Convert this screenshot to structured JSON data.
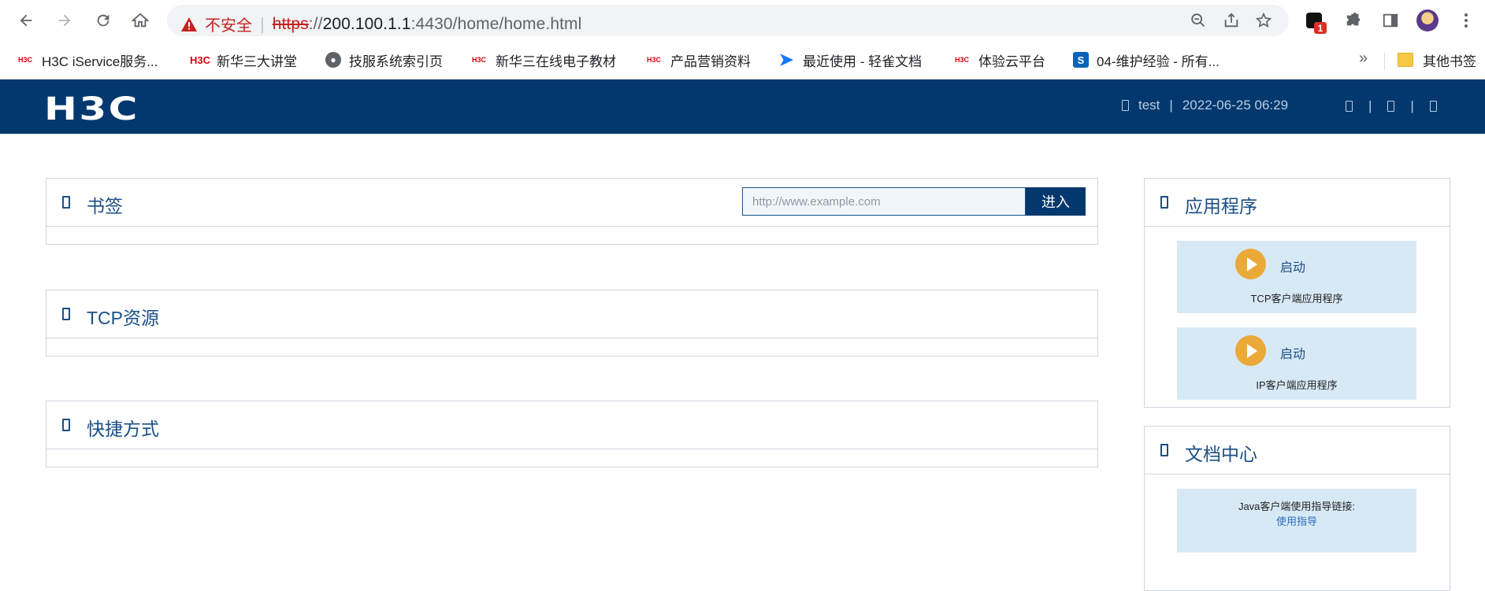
{
  "browser": {
    "security_label": "不安全",
    "url_scheme": "https",
    "url_sep": "://",
    "url_host": "200.100.1.1",
    "url_rest": ":4430/home/home.html",
    "extension_badge": "1"
  },
  "bookmarks": [
    {
      "label": "H3C iService服务...",
      "icon": "h3c-icon"
    },
    {
      "label": "新华三大讲堂",
      "icon": "h3c-icon"
    },
    {
      "label": "技服系统索引页",
      "icon": "globe-icon"
    },
    {
      "label": "新华三在线电子教材",
      "icon": "h3c-icon"
    },
    {
      "label": "产品营销资料",
      "icon": "h3c-icon"
    },
    {
      "label": "最近使用 - 轻雀文档",
      "icon": "feather-icon"
    },
    {
      "label": "体验云平台",
      "icon": "h3c-icon"
    },
    {
      "label": "04-维护经验 - 所有...",
      "icon": "sharepoint-icon"
    }
  ],
  "bookmarks_more": "»",
  "other_bookmarks": "其他书签",
  "header": {
    "logo": "H3C",
    "user": "test",
    "separator": "|",
    "datetime": "2022-06-25 06:29"
  },
  "bookmark_panel": {
    "title": "书签",
    "input_placeholder": "http://www.example.com",
    "go_label": "进入"
  },
  "tcp_panel": {
    "title": "TCP资源"
  },
  "shortcut_panel": {
    "title": "快捷方式"
  },
  "apps_panel": {
    "title": "应用程序",
    "items": [
      {
        "launch": "启动",
        "name": "TCP客户端应用程序"
      },
      {
        "launch": "启动",
        "name": "IP客户端应用程序"
      }
    ]
  },
  "docs_panel": {
    "title": "文档中心",
    "text": "Java客户端使用指导链接:",
    "link": "使用指导"
  }
}
